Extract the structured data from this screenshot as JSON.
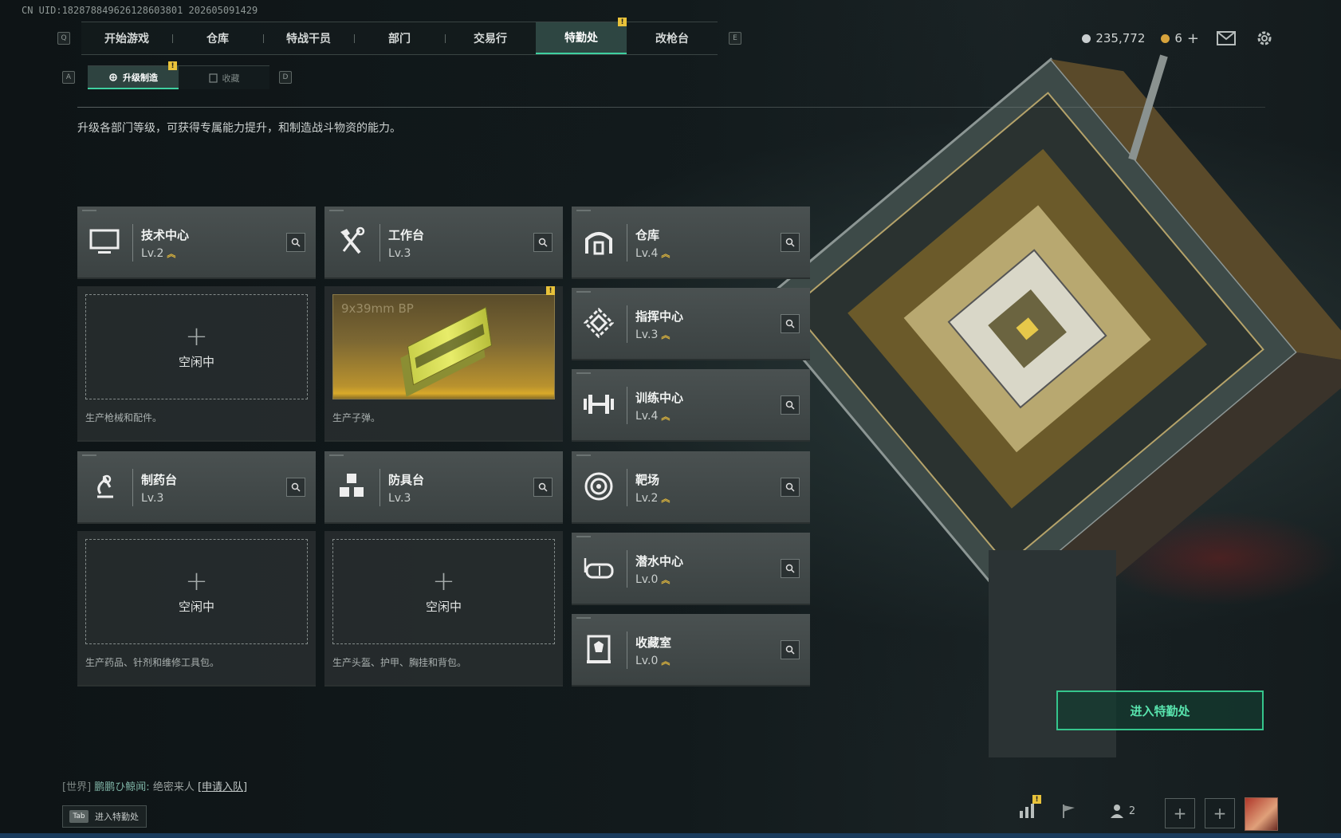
{
  "uid": "CN UID:182878849626128603801 202605091429",
  "nav": {
    "left_key": "Q",
    "right_key": "E",
    "tabs": [
      {
        "label": "开始游戏"
      },
      {
        "label": "仓库"
      },
      {
        "label": "特战干员"
      },
      {
        "label": "部门"
      },
      {
        "label": "交易行"
      },
      {
        "label": "特勤处",
        "active": true,
        "alert": "!"
      },
      {
        "label": "改枪台"
      }
    ]
  },
  "subnav": {
    "left_key": "A",
    "right_key": "D",
    "tabs": [
      {
        "label": "升级制造",
        "active": true,
        "alert": "!"
      },
      {
        "label": "收藏"
      }
    ]
  },
  "description": "升级各部门等级，可获得专属能力提升，和制造战斗物资的能力。",
  "currency": {
    "hafcoin": "235,772",
    "tickets": "6",
    "plus": "+",
    "hafcoin_color": "#c9ced0",
    "ticket_color": "#d7a33c"
  },
  "facilities": [
    {
      "name": "技术中心",
      "level": "Lv.2",
      "upgradable": true,
      "icon": "monitor-icon"
    },
    {
      "name": "工作台",
      "level": "Lv.3",
      "upgradable": false,
      "icon": "hammer-wrench-icon"
    },
    {
      "name": "仓库",
      "level": "Lv.4",
      "upgradable": true,
      "icon": "warehouse-icon"
    },
    {
      "name": "指挥中心",
      "level": "Lv.3",
      "upgradable": true,
      "icon": "command-icon"
    },
    {
      "name": "训练中心",
      "level": "Lv.4",
      "upgradable": true,
      "icon": "dumbbell-icon"
    },
    {
      "name": "制药台",
      "level": "Lv.3",
      "upgradable": false,
      "icon": "microscope-icon"
    },
    {
      "name": "防具台",
      "level": "Lv.3",
      "upgradable": false,
      "icon": "cubes-icon"
    },
    {
      "name": "靶场",
      "level": "Lv.2",
      "upgradable": true,
      "icon": "target-icon"
    },
    {
      "name": "潜水中心",
      "level": "Lv.0",
      "upgradable": true,
      "icon": "diving-mask-icon"
    },
    {
      "name": "收藏室",
      "level": "Lv.0",
      "upgradable": true,
      "icon": "collection-icon"
    }
  ],
  "production": [
    {
      "status": "空闲中",
      "description": "生产枪械和配件。"
    },
    {
      "item": "9x39mm BP",
      "description": "生产子弹。",
      "alert": "!"
    },
    {
      "status": "空闲中",
      "description": "生产药品、针剂和维修工具包。"
    },
    {
      "status": "空闲中",
      "description": "生产头盔、护甲、胸挂和背包。"
    }
  ],
  "enter_button": "进入特勤处",
  "accent_color": "#3fd0a0",
  "chat": {
    "channel": "[世界]",
    "name": "鹏鹏ひ鲸闻:",
    "message": "绝密来人",
    "link": "[申请入队]"
  },
  "tab_hint": {
    "key": "Tab",
    "label": "进入特勤处"
  },
  "party_count": "2"
}
